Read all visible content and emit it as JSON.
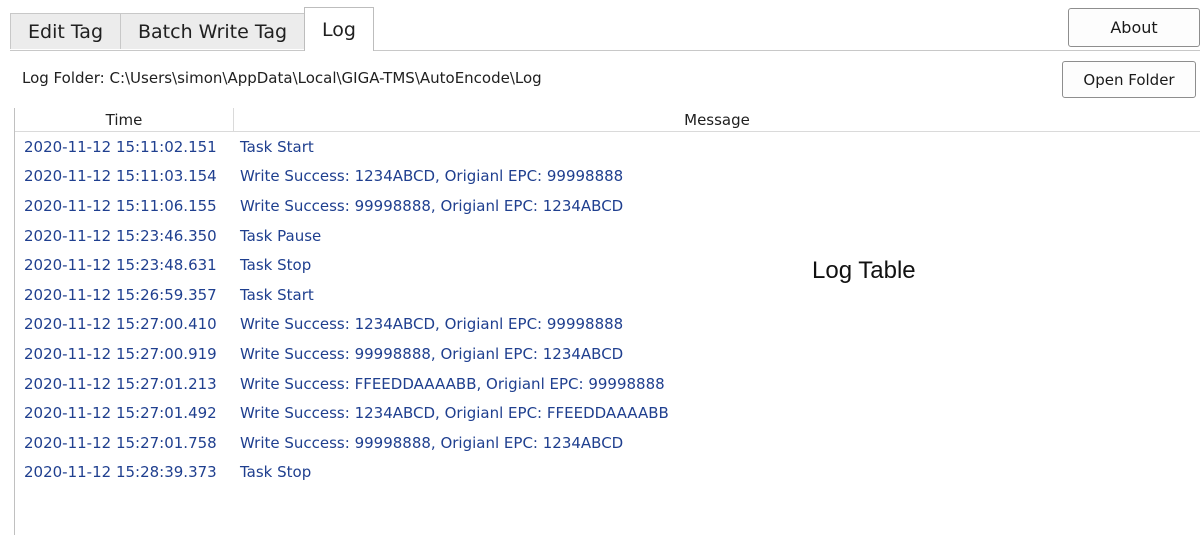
{
  "tabs": [
    {
      "label": "Edit Tag",
      "active": false
    },
    {
      "label": "Batch Write Tag",
      "active": false
    },
    {
      "label": "Log",
      "active": true
    }
  ],
  "about_button": "About",
  "log_folder": {
    "label": "Log Folder: C:\\Users\\simon\\AppData\\Local\\GIGA-TMS\\AutoEncode\\Log",
    "open_button": "Open Folder"
  },
  "log_table": {
    "columns": [
      "Time",
      "Message"
    ],
    "overlay_label": "Log Table",
    "rows": [
      {
        "time": "2020-11-12 15:11:02.151",
        "message": "Task Start"
      },
      {
        "time": "2020-11-12 15:11:03.154",
        "message": "Write Success: 1234ABCD, Origianl EPC: 99998888"
      },
      {
        "time": "2020-11-12 15:11:06.155",
        "message": "Write Success: 99998888, Origianl EPC: 1234ABCD"
      },
      {
        "time": "2020-11-12 15:23:46.350",
        "message": "Task Pause"
      },
      {
        "time": "2020-11-12 15:23:48.631",
        "message": "Task Stop"
      },
      {
        "time": "2020-11-12 15:26:59.357",
        "message": "Task Start"
      },
      {
        "time": "2020-11-12 15:27:00.410",
        "message": "Write Success: 1234ABCD, Origianl EPC: 99998888"
      },
      {
        "time": "2020-11-12 15:27:00.919",
        "message": "Write Success: 99998888, Origianl EPC: 1234ABCD"
      },
      {
        "time": "2020-11-12 15:27:01.213",
        "message": "Write Success: FFEEDDAAAABB, Origianl EPC: 99998888"
      },
      {
        "time": "2020-11-12 15:27:01.492",
        "message": "Write Success: 1234ABCD, Origianl EPC: FFEEDDAAAABB"
      },
      {
        "time": "2020-11-12 15:27:01.758",
        "message": "Write Success: 99998888, Origianl EPC: 1234ABCD"
      },
      {
        "time": "2020-11-12 15:28:39.373",
        "message": "Task Stop"
      }
    ]
  },
  "colors": {
    "row_text": "#1f3f8f",
    "tab_inactive_bg": "#ececec",
    "border": "#c8c8c8"
  }
}
